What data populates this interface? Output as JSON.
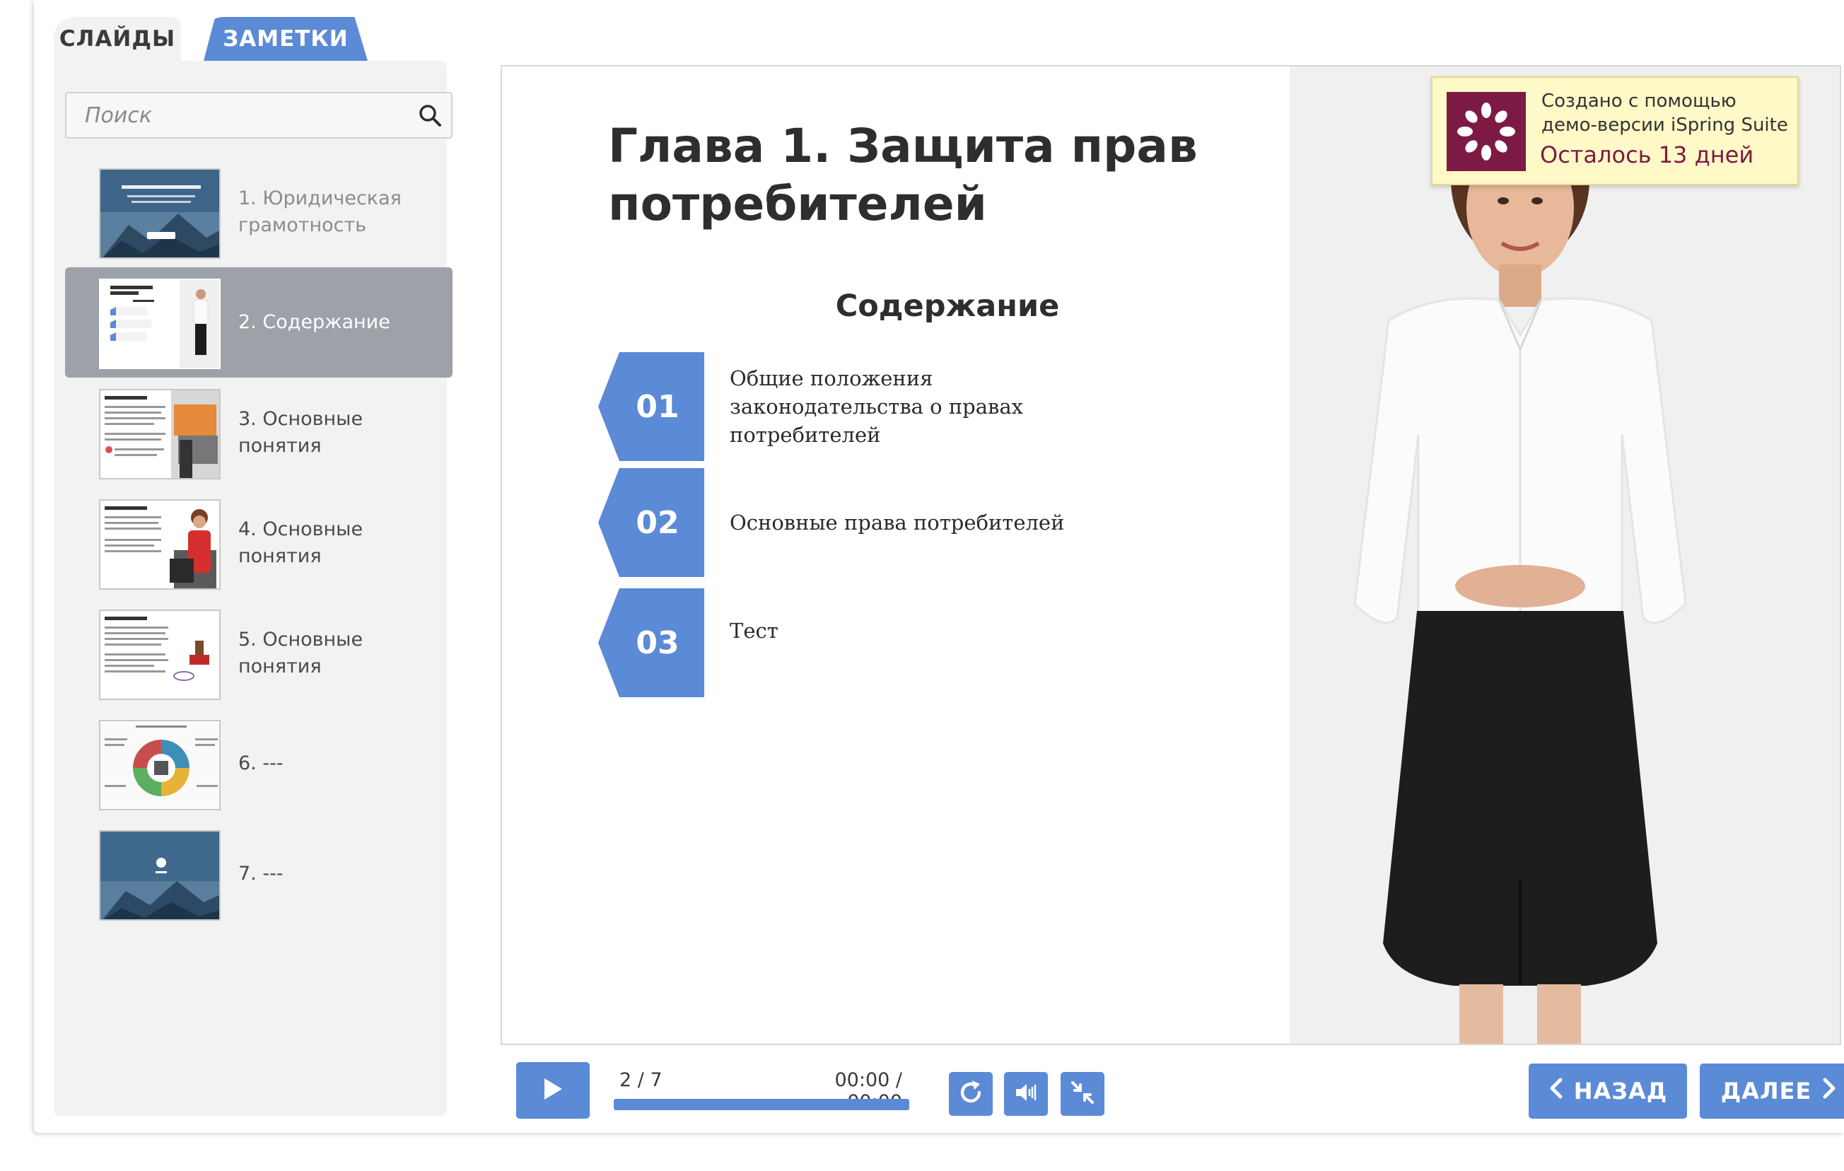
{
  "tabs": {
    "slides": "СЛАЙДЫ",
    "notes": "ЗАМЕТКИ"
  },
  "search": {
    "placeholder": "Поиск"
  },
  "slides": [
    {
      "label": "1. Юридическая грамотность"
    },
    {
      "label": "2. Содержание"
    },
    {
      "label": "3. Основные понятия"
    },
    {
      "label": "4. Основные понятия"
    },
    {
      "label": "5. Основные понятия"
    },
    {
      "label": "6. ---"
    },
    {
      "label": "7. ---"
    }
  ],
  "slide": {
    "title": "Глава 1.  Защита прав потребителей",
    "contents_heading": "Содержание",
    "items": [
      {
        "num": "01",
        "text": "Общие положения законодательства о правах потребителей"
      },
      {
        "num": "02",
        "text": "Основные права потребителей"
      },
      {
        "num": "03",
        "text": "Тест"
      }
    ]
  },
  "watermark": {
    "line1": "Создано с помощью",
    "line2": "демо-версии iSpring Suite",
    "line3": "Осталось 13 дней"
  },
  "controls": {
    "counter": "2 / 7",
    "time": "00:00 / 00:00",
    "progress": 1.0,
    "back": "НАЗАД",
    "next": "ДАЛЕЕ"
  },
  "colors": {
    "accent": "#5b8ad6",
    "watermark_brand": "#7d1a43"
  },
  "icons": [
    "search-icon",
    "play-icon",
    "replay-icon",
    "volume-icon",
    "exit-fullscreen-icon",
    "chevron-left-icon",
    "chevron-right-icon",
    "ispring-logo-icon"
  ]
}
